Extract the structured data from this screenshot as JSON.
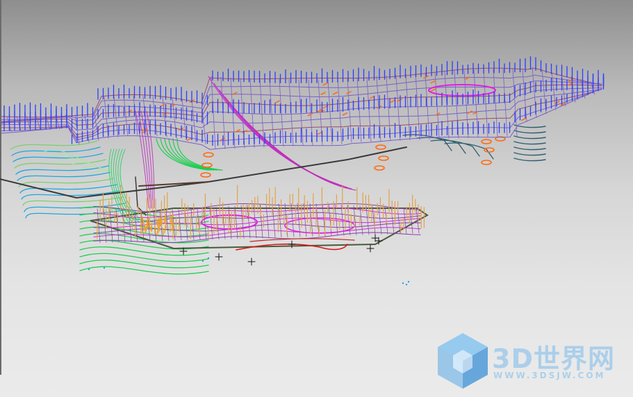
{
  "viewport": {
    "background": "gradient-gray",
    "colors": {
      "upper_wireframe": "#7a5fc8",
      "upper_vectors": "#2b3dff",
      "lower_vectors": "#e2a24a",
      "magenta": "#e020e0",
      "orange": "#ff6a10",
      "green": "#1ccf50",
      "cyan": "#1aa8e0",
      "red": "#d81818",
      "teal": "#2a5e70",
      "dark_line": "#3a3a3a"
    }
  },
  "watermark": {
    "logo": "3d-cube-logo",
    "brand": "3D世界网",
    "url": "WWW.3DSJW.COM"
  }
}
